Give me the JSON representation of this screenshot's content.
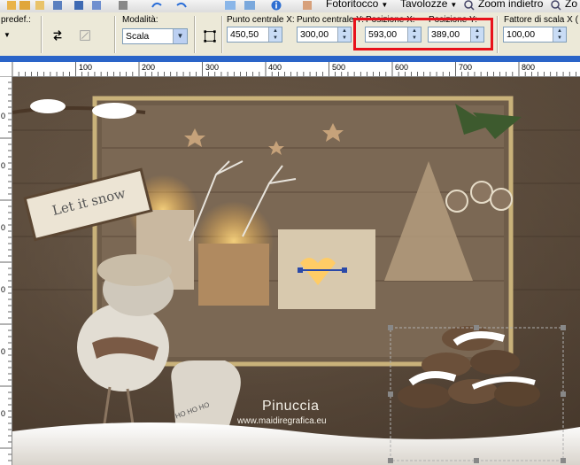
{
  "topbar": {
    "preset_label": "predef.:",
    "menu_fotoritocco": "Fotoritocco",
    "menu_tavolozze": "Tavolozze",
    "zoom_label": "Zoom indietro",
    "zo_label": "Zo"
  },
  "options": {
    "modalita_label": "Modalità:",
    "modalita_value": "Scala",
    "centro_x_label": "Punto centrale X:",
    "centro_x_value": "450,50",
    "centro_y_label": "Punto centrale Y:",
    "centro_y_value": "300,00",
    "pos_x_label": "Posizione X:",
    "pos_x_value": "593,00",
    "pos_y_label": "Posizione Y:",
    "pos_y_value": "389,00",
    "scala_label": "Fattore di scala X (",
    "scala_value": "100,00"
  },
  "ruler": {
    "h_marks": [
      "100",
      "200",
      "300",
      "400",
      "500",
      "600",
      "700",
      "800"
    ],
    "v_marks": [
      "0",
      "0",
      "0",
      "0",
      "0",
      "0"
    ]
  },
  "canvas": {
    "sign_text": "Let it snow",
    "watermark_name": "Pinuccia",
    "watermark_url": "www.maidiregrafica.eu",
    "bag_text": "HO HO HO"
  },
  "colors": {
    "highlight": "#e8121b",
    "selection_handles": "#888888"
  }
}
